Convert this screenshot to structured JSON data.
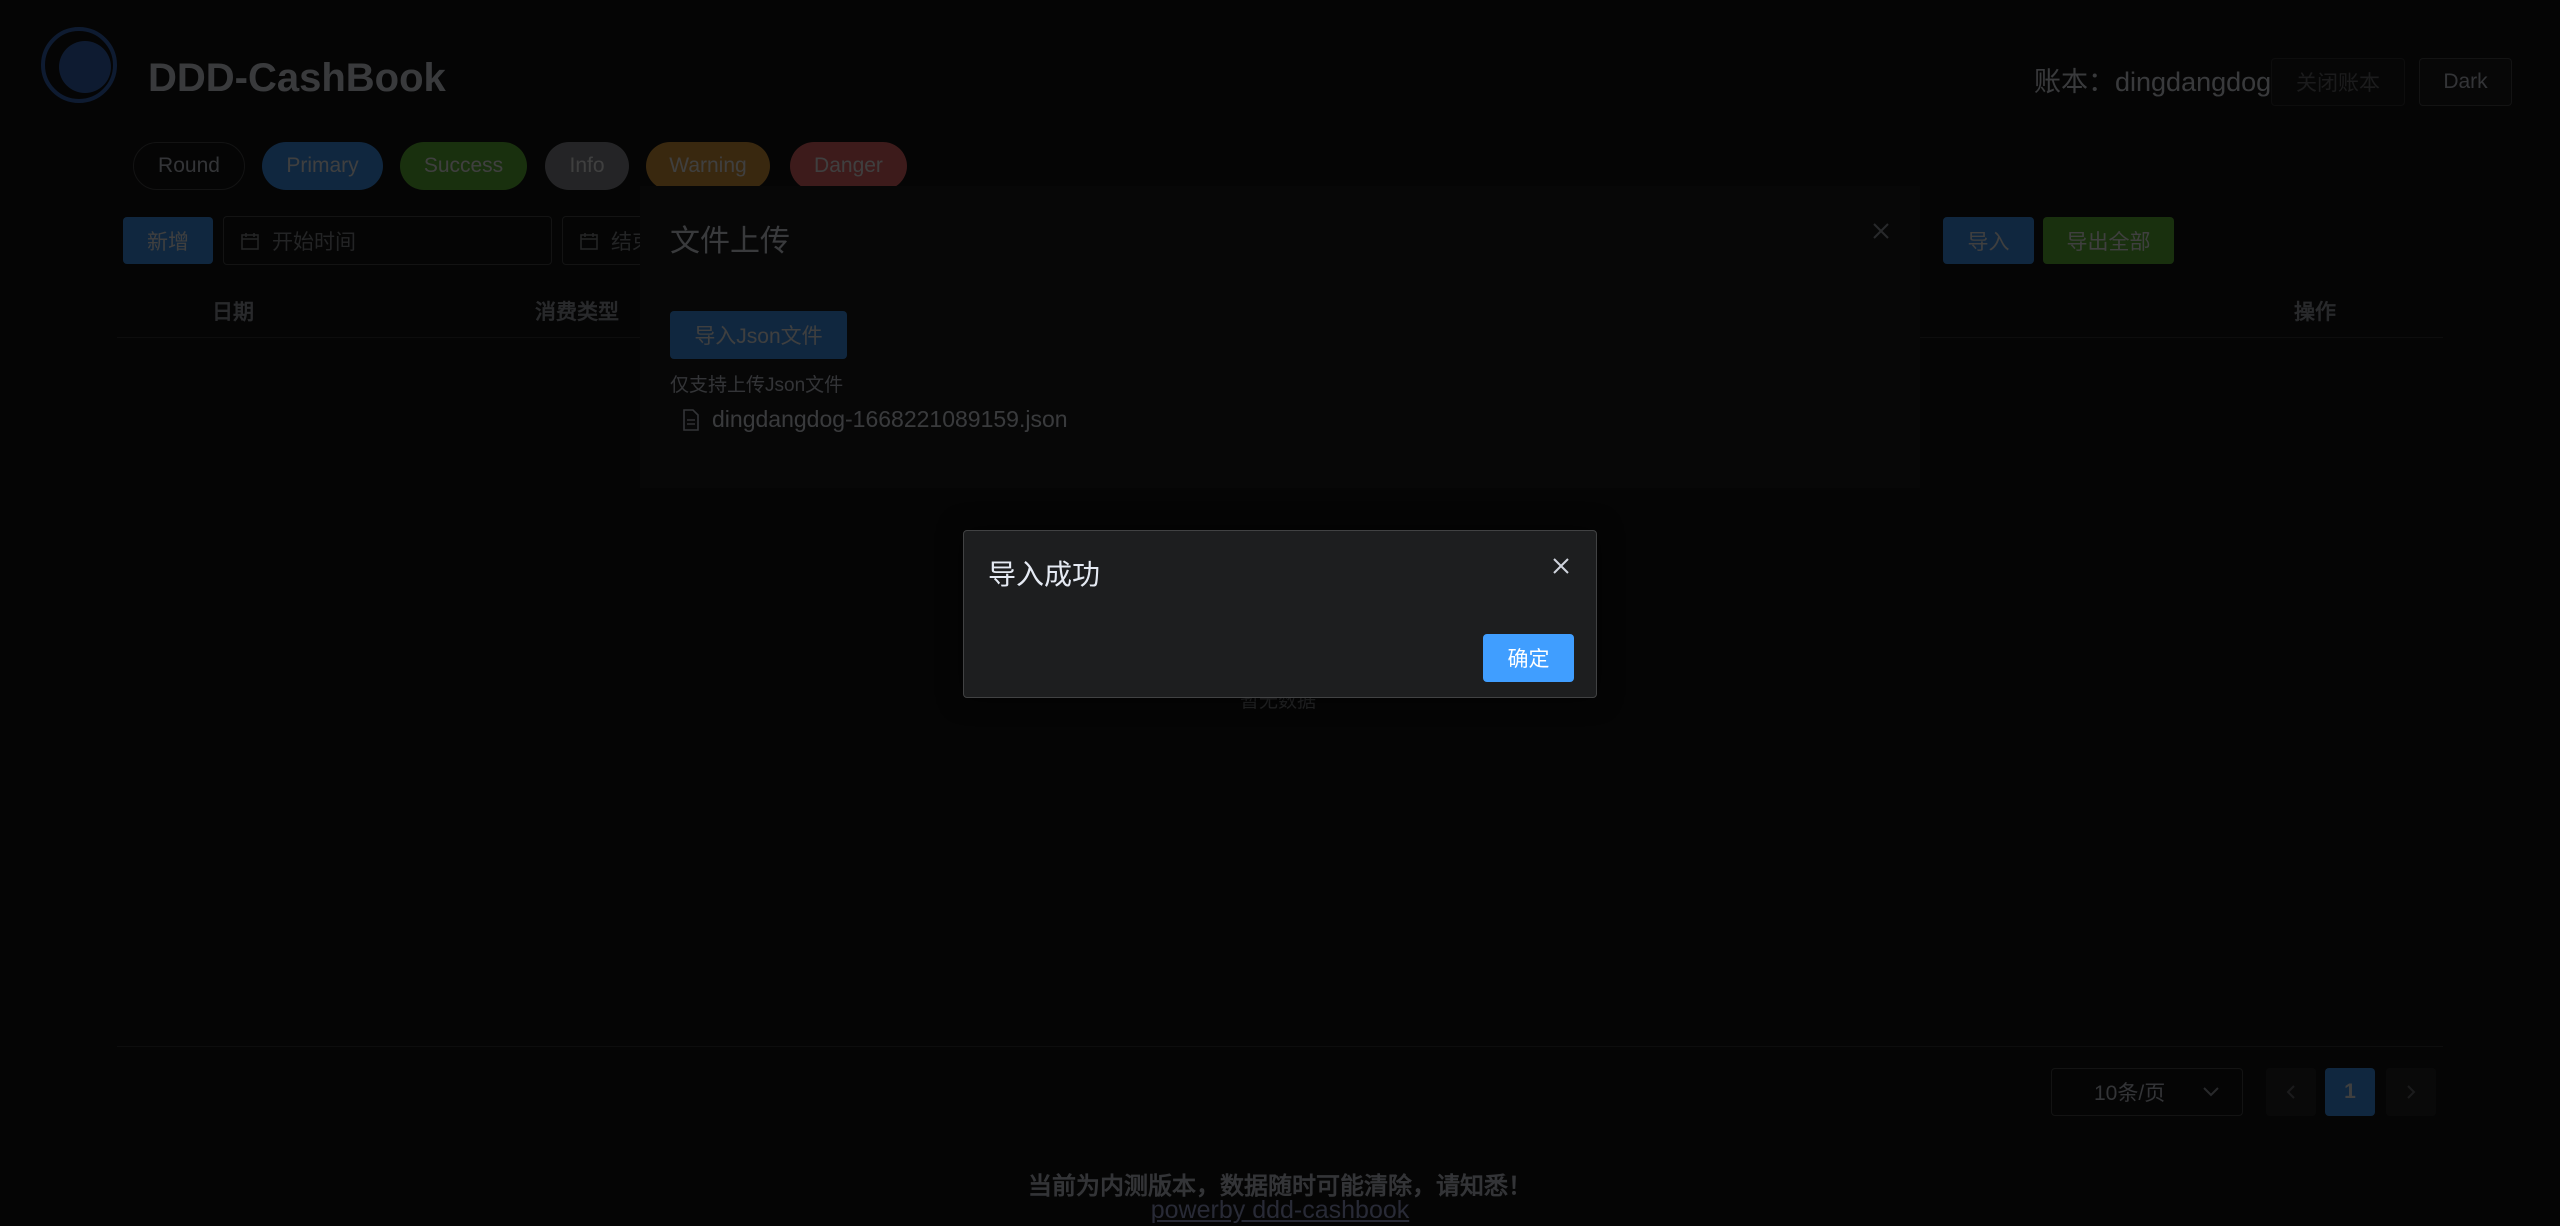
{
  "header": {
    "app_title": "DDD-CashBook",
    "account_label": "账本：dingdangdog",
    "close_book_label": "关闭账本",
    "theme_label": "Dark"
  },
  "demo_buttons": [
    {
      "label": "Round"
    },
    {
      "label": "Primary"
    },
    {
      "label": "Success"
    },
    {
      "label": "Info"
    },
    {
      "label": "Warning"
    },
    {
      "label": "Danger"
    }
  ],
  "toolbar": {
    "add_label": "新增",
    "start_date_placeholder": "开始时间",
    "end_date_placeholder": "结束时间",
    "import_label": "导入",
    "export_all_label": "导出全部"
  },
  "table": {
    "columns": [
      "日期",
      "消费类型",
      "操作"
    ],
    "empty_text": "暂无数据"
  },
  "pagination": {
    "page_size": "10条/页",
    "current_page": "1"
  },
  "upload_dialog": {
    "title": "文件上传",
    "upload_button": "导入Json文件",
    "tip": "仅支持上传Json文件",
    "file_name": "dingdangdog-1668221089159.json"
  },
  "message_box": {
    "title": "导入成功",
    "confirm_label": "确定"
  },
  "footer": {
    "notice": "当前为内测版本，数据随时可能清除，请知悉！",
    "link": "powerby ddd-cashbook"
  },
  "colors": {
    "primary": "#409eff",
    "success": "#67c23a",
    "info": "#909399",
    "warning": "#e6a23c",
    "danger": "#f56c6c"
  }
}
